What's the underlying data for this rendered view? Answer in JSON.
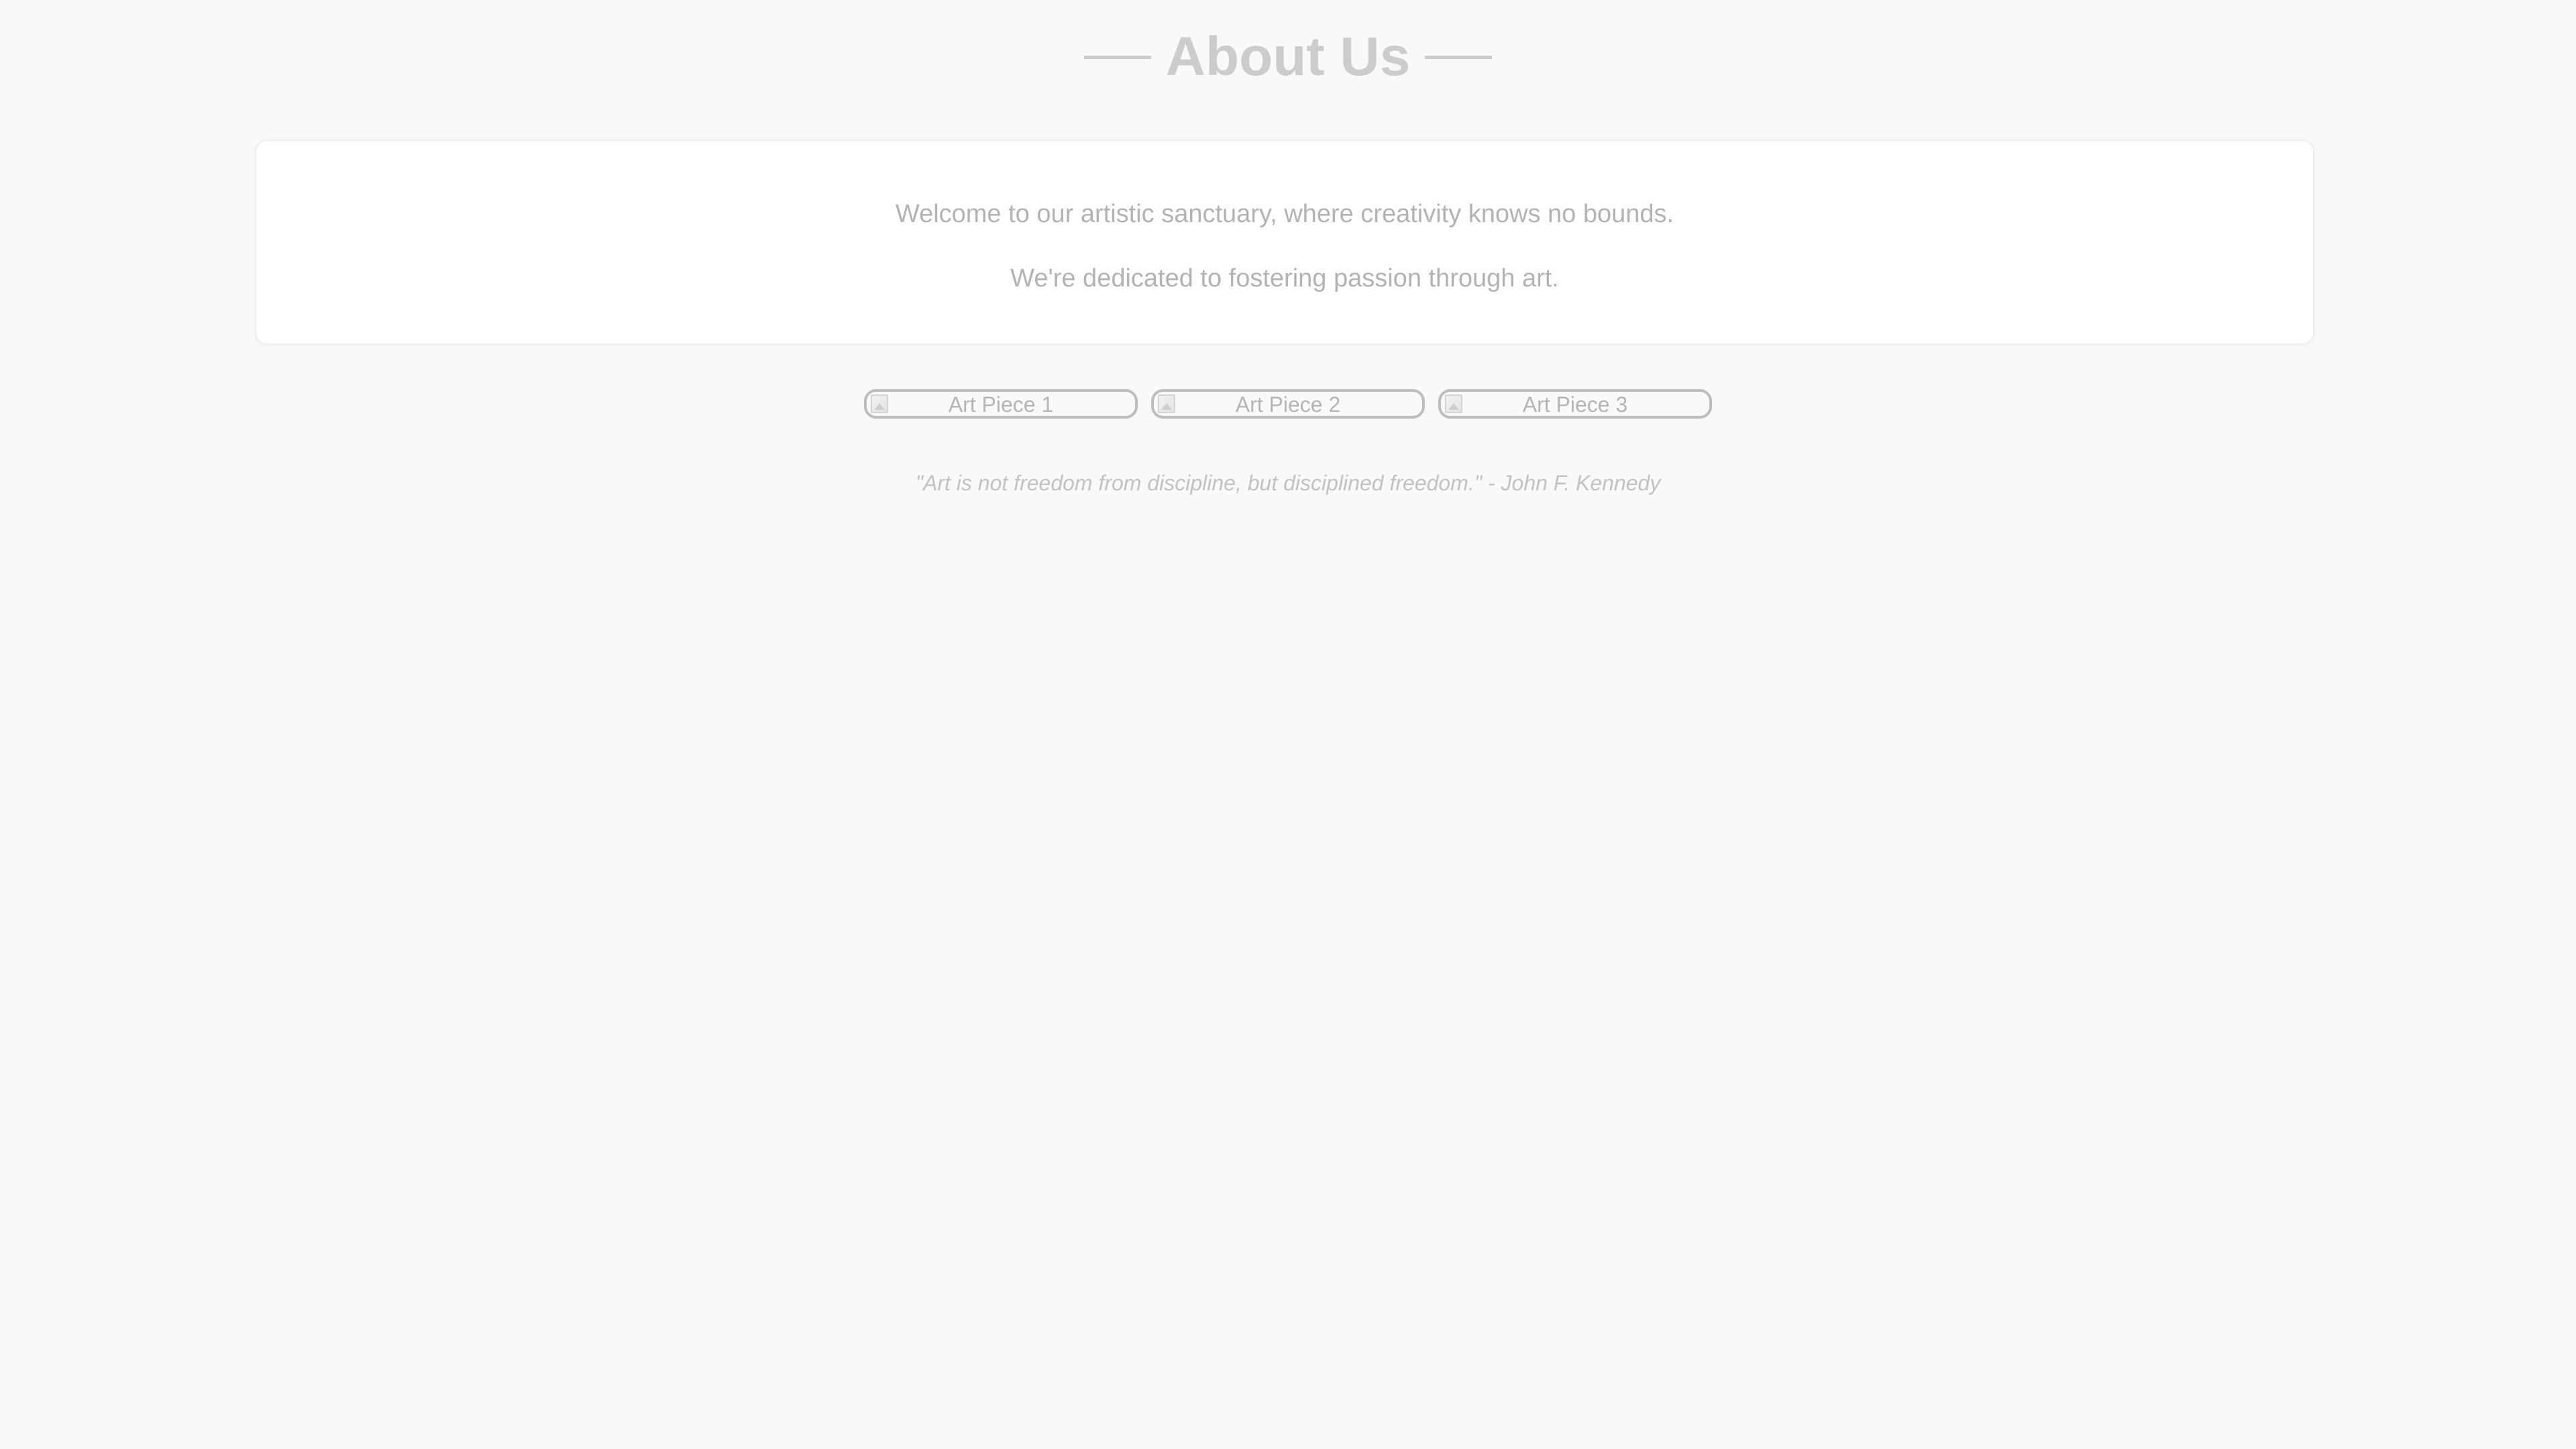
{
  "header": {
    "title": "About Us"
  },
  "intro": {
    "lines": [
      "Welcome to our artistic sanctuary, where creativity knows no bounds.",
      "We're dedicated to fostering passion through art."
    ]
  },
  "gallery": {
    "items": [
      {
        "alt": "Art Piece 1",
        "icon": "broken-image-icon"
      },
      {
        "alt": "Art Piece 2",
        "icon": "broken-image-icon"
      },
      {
        "alt": "Art Piece 3",
        "icon": "broken-image-icon"
      }
    ]
  },
  "quote": {
    "text": "\"Art is not freedom from discipline, but disciplined freedom.\" - John F. Kennedy"
  },
  "colors": {
    "background": "#f9f9f9",
    "title": "#cccccc",
    "body_text": "#b3b3b3",
    "card_background": "#ffffff",
    "image_border": "#bdbdbd"
  }
}
